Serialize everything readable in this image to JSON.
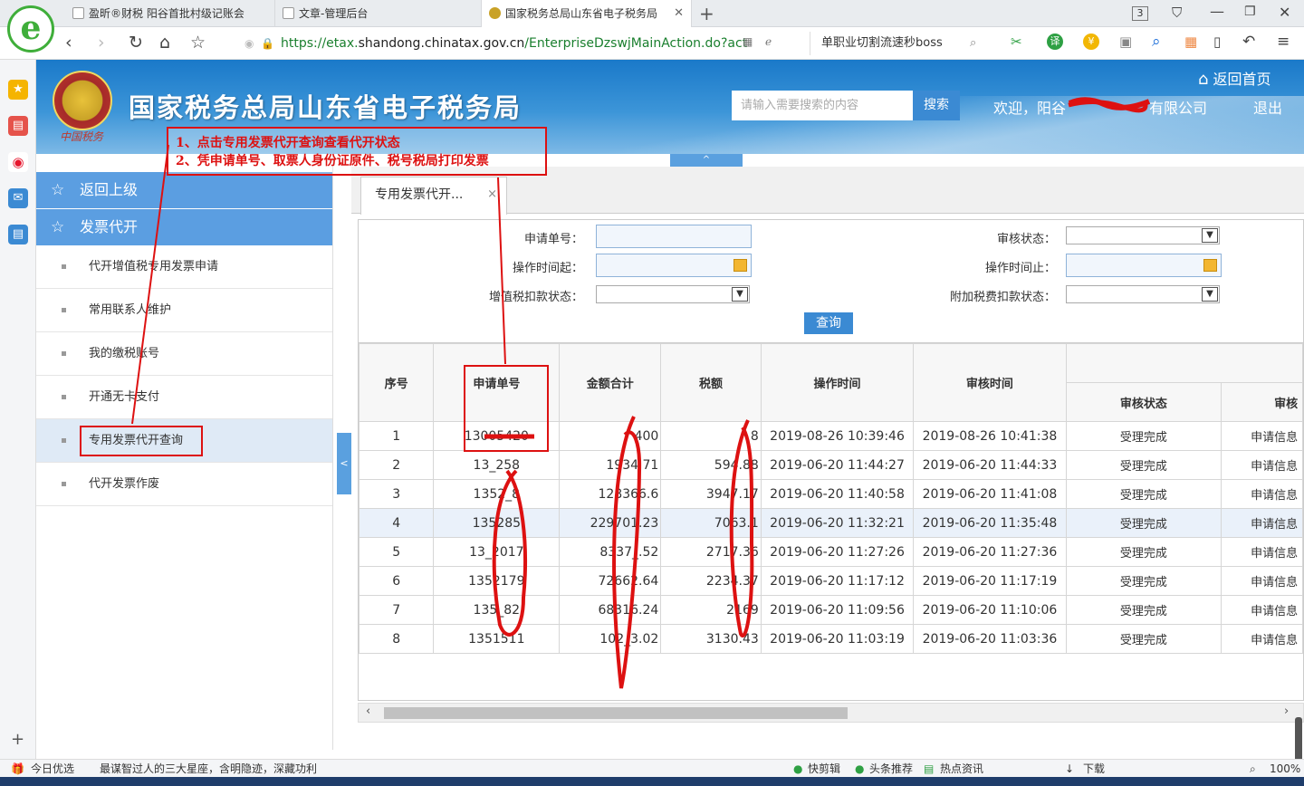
{
  "browser": {
    "tabs": [
      {
        "label": "盈昕®财税 阳谷首批村级记账会"
      },
      {
        "label": "文章-管理后台"
      },
      {
        "label": "国家税务总局山东省电子税务局"
      }
    ],
    "tab_count": "3",
    "url_prefix": "https://etax.",
    "url_domain": "shandong.chinatax.gov.cn",
    "url_path": "/EnterpriseDzswjMainAction.do?act",
    "search_text": "单职业切割流速秒boss",
    "logo_glyph": "e",
    "accent": "#3fae3a"
  },
  "header": {
    "title": "国家税务总局山东省电子税务局",
    "emblem_text": "中国税务",
    "search_placeholder": "请输入需要搜索的内容",
    "search_button": "搜索",
    "welcome": "欢迎，阳谷",
    "welcome_tail": "有限公司",
    "home": "返回首页",
    "logout": "退出",
    "collapse_glyph": "^"
  },
  "sidebar": {
    "back": "返回上级",
    "section": "发票代开",
    "items": [
      {
        "label": "代开增值税专用发票申请"
      },
      {
        "label": "常用联系人维护"
      },
      {
        "label": "我的缴税账号"
      },
      {
        "label": "开通无卡支付"
      },
      {
        "label": "专用发票代开查询"
      },
      {
        "label": "代开发票作废"
      }
    ]
  },
  "content": {
    "tab_label": "专用发票代开...",
    "tab_close": "×",
    "form": {
      "apply_no": "申请单号：",
      "audit_status": "审核状态：",
      "op_time_from": "操作时间起：",
      "op_time_to": "操作时间止：",
      "vat_deduct": "增值税扣款状态：",
      "surtax_deduct": "附加税费扣款状态：",
      "query": "查询"
    },
    "table": {
      "headers": {
        "seq": "序号",
        "apply_no": "申请单号",
        "amount": "金额合计",
        "tax": "税额",
        "op_time": "操作时间",
        "audit_time": "审核时间",
        "audit_status": "审核状态",
        "next": "审核"
      },
      "rows": [
        {
          "seq": "1",
          "no": "13005420",
          "amount": "400",
          "tax": "8",
          "op": "2019-08-26 10:39:46",
          "audit": "2019-08-26 10:41:38",
          "status": "受理完成",
          "next": "申请信息"
        },
        {
          "seq": "2",
          "no": "13_258",
          "amount": "1934.71",
          "tax": "594.88",
          "op": "2019-06-20 11:44:27",
          "audit": "2019-06-20 11:44:33",
          "status": "受理完成",
          "next": "申请信息"
        },
        {
          "seq": "3",
          "no": "1352_8",
          "amount": "128366.6",
          "tax": "3947.17",
          "op": "2019-06-20 11:40:58",
          "audit": "2019-06-20 11:41:08",
          "status": "受理完成",
          "next": "申请信息"
        },
        {
          "seq": "4",
          "no": "135285",
          "amount": "229701.23",
          "tax": "7063.1",
          "op": "2019-06-20 11:32:21",
          "audit": "2019-06-20 11:35:48",
          "status": "受理完成",
          "next": "申请信息"
        },
        {
          "seq": "5",
          "no": "13_2017",
          "amount": "8337_.52",
          "tax": "2717.36",
          "op": "2019-06-20 11:27:26",
          "audit": "2019-06-20 11:27:36",
          "status": "受理完成",
          "next": "申请信息"
        },
        {
          "seq": "6",
          "no": "1352179",
          "amount": "72662.64",
          "tax": "2234.37",
          "op": "2019-06-20 11:17:12",
          "audit": "2019-06-20 11:17:19",
          "status": "受理完成",
          "next": "申请信息"
        },
        {
          "seq": "7",
          "no": "135_82",
          "amount": "68316.24",
          "tax": "2169",
          "op": "2019-06-20 11:09:56",
          "audit": "2019-06-20 11:10:06",
          "status": "受理完成",
          "next": "申请信息"
        },
        {
          "seq": "8",
          "no": "1351511",
          "amount": "102_3.02",
          "tax": "3130.43",
          "op": "2019-06-20 11:03:19",
          "audit": "2019-06-20 11:03:36",
          "status": "受理完成",
          "next": "申请信息"
        }
      ]
    }
  },
  "annotation": {
    "line1": "1、点击专用发票代开查询查看代开状态",
    "line2": "2、凭申请单号、取票人身份证原件、税号税局打印发票",
    "color": "#d11111"
  },
  "statusbar": {
    "left": "今日优选",
    "news": "最谋智过人的三大星座，含明隐迹，深藏功利",
    "items": [
      "快剪辑",
      "头条推荐",
      "热点资讯",
      "下载"
    ],
    "zoom": "100%"
  }
}
